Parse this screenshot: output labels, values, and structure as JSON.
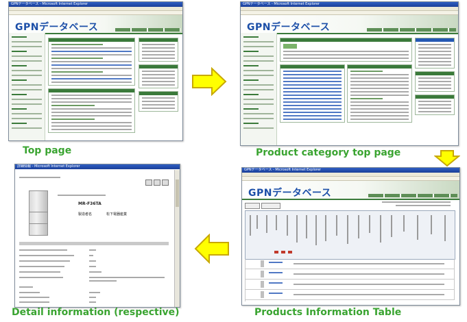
{
  "screens": {
    "top_page": {
      "window_title": "GPNデータベース - Microsoft Internet Explorer",
      "logo": "GPNデータベース",
      "caption": "Top page"
    },
    "category_page": {
      "window_title": "GPNデータベース - Microsoft Internet Explorer",
      "logo": "GPNデータベース",
      "caption": "Product category top page"
    },
    "products_table": {
      "window_title": "GPNデータベース - Microsoft Internet Explorer",
      "logo": "GPNデータベース",
      "caption": "Products Information Table"
    },
    "detail": {
      "window_title": "詳細情報 - Microsoft Internet Explorer",
      "model": "MR-F36TA",
      "maker_label": "製造者名",
      "maker": "松下電器産業",
      "caption": "Detail information (respective)"
    }
  },
  "colors": {
    "caption": "#3aa431",
    "arrow_fill": "#ffff00",
    "arrow_stroke": "#c8a800",
    "gpn_green": "#3a7a3a",
    "gpn_blue": "#1c4fa8"
  }
}
